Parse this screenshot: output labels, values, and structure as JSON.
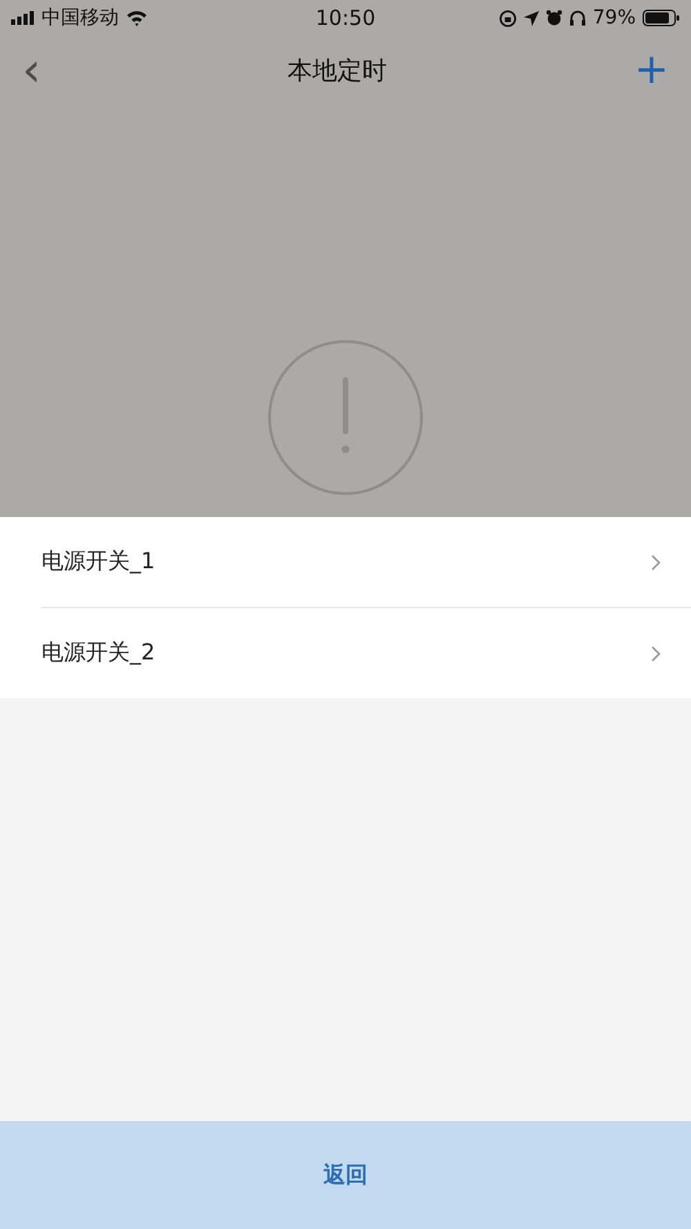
{
  "status_bar": {
    "carrier": "中国移动",
    "time": "10:50",
    "battery": "79%"
  },
  "nav": {
    "back": "‹",
    "title": "本地定时",
    "add": "+"
  },
  "sheet": {
    "items": [
      {
        "label": "电源开关_1"
      },
      {
        "label": "电源开关_2"
      }
    ]
  },
  "footer": {
    "button": "返回"
  }
}
